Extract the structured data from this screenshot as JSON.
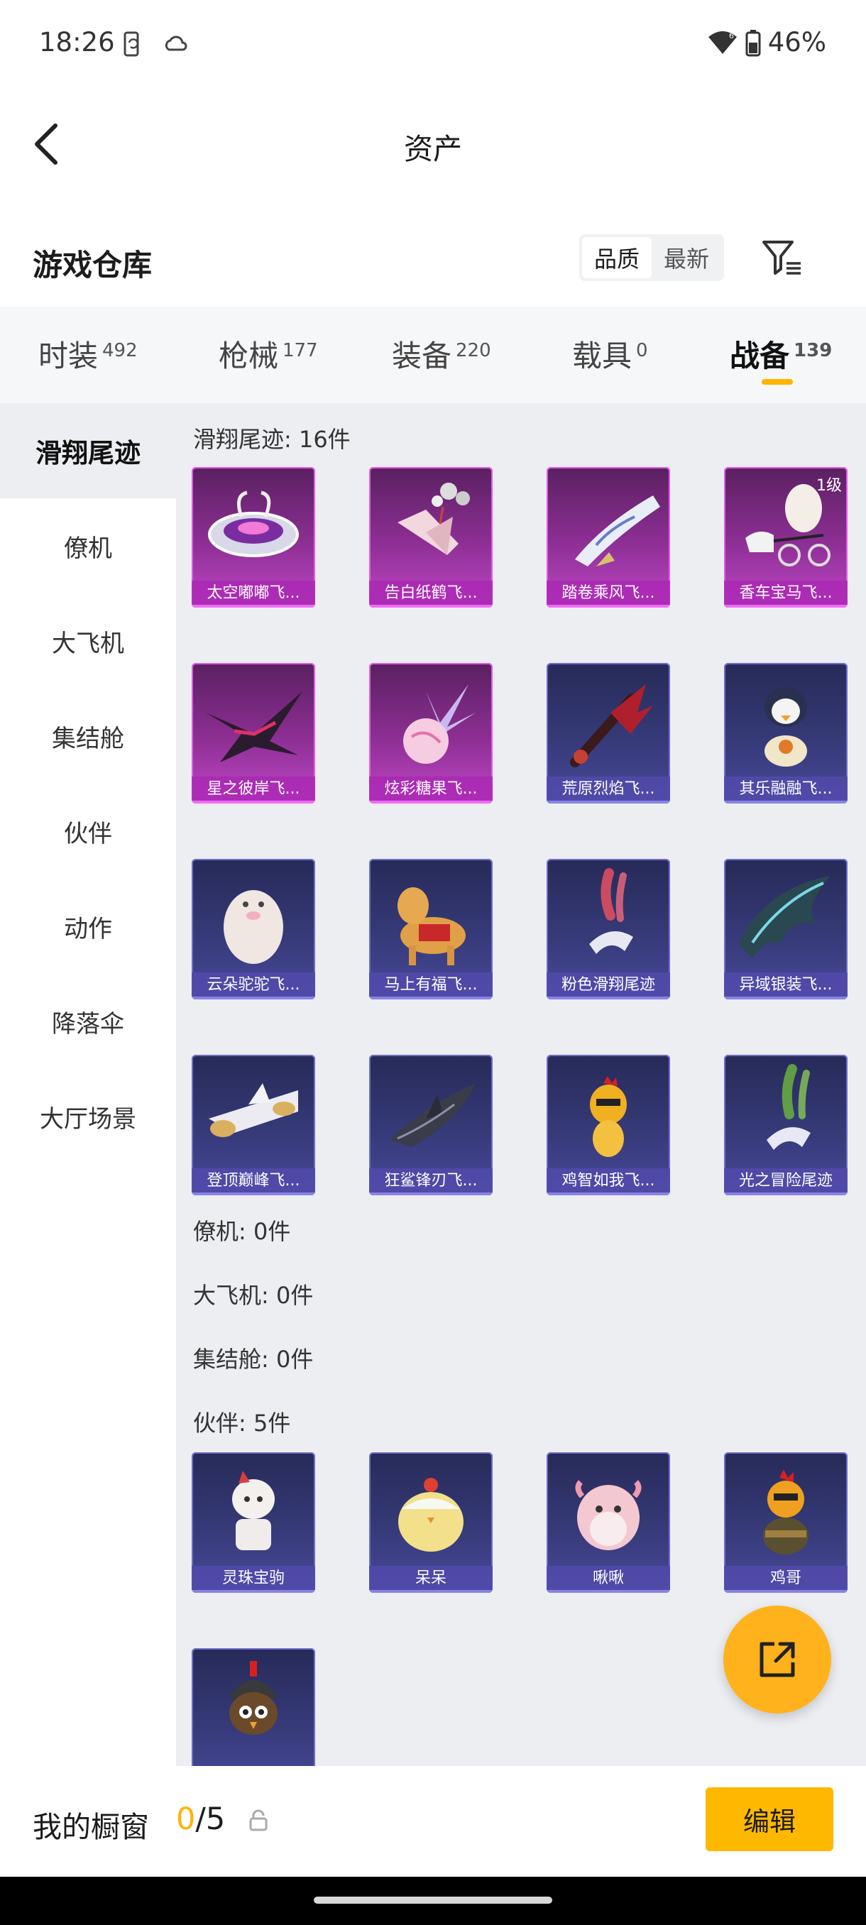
{
  "status_bar": {
    "time": "18:26",
    "battery": "46%"
  },
  "header": {
    "title": "资产"
  },
  "warehouse": {
    "title": "游戏仓库",
    "sort_options": [
      "品质",
      "最新"
    ],
    "active_sort": "品质"
  },
  "tabs": [
    {
      "label": "时装",
      "count": "492"
    },
    {
      "label": "枪械",
      "count": "177"
    },
    {
      "label": "装备",
      "count": "220"
    },
    {
      "label": "载具",
      "count": "0"
    },
    {
      "label": "战备",
      "count": "139"
    }
  ],
  "active_tab": "战备",
  "sidebar": {
    "items": [
      "滑翔尾迹",
      "僚机",
      "大飞机",
      "集结舱",
      "伙伴",
      "动作",
      "降落伞",
      "大厅场景"
    ],
    "active": "滑翔尾迹"
  },
  "sections": {
    "glide_trail": {
      "title": "滑翔尾迹: 16件",
      "items": [
        {
          "name": "太空嘟嘟飞...",
          "rarity": "purple",
          "icon": "space-ufo-icon"
        },
        {
          "name": "告白纸鹤飞...",
          "rarity": "purple",
          "icon": "paper-crane-icon"
        },
        {
          "name": "踏卷乘风飞...",
          "rarity": "purple",
          "icon": "scroll-icon"
        },
        {
          "name": "香车宝马飞...",
          "rarity": "purple",
          "icon": "carriage-icon",
          "level": "1级"
        },
        {
          "name": "星之彼岸飞...",
          "rarity": "purple",
          "icon": "dark-wing-icon"
        },
        {
          "name": "炫彩糖果飞...",
          "rarity": "purple",
          "icon": "candy-icon"
        },
        {
          "name": "荒原烈焰飞...",
          "rarity": "blue",
          "icon": "flame-glider-icon"
        },
        {
          "name": "其乐融融飞...",
          "rarity": "blue",
          "icon": "penguin-icon"
        },
        {
          "name": "云朵驼驼飞...",
          "rarity": "blue",
          "icon": "alpaca-icon"
        },
        {
          "name": "马上有福飞...",
          "rarity": "blue",
          "icon": "horse-icon"
        },
        {
          "name": "粉色滑翔尾迹",
          "rarity": "blue",
          "icon": "pink-smoke-icon"
        },
        {
          "name": "异域银装飞...",
          "rarity": "blue",
          "icon": "silver-wing-icon"
        },
        {
          "name": "登顶巅峰飞...",
          "rarity": "blue",
          "icon": "jet-icon"
        },
        {
          "name": "狂鲨锋刃飞...",
          "rarity": "blue",
          "icon": "shark-icon"
        },
        {
          "name": "鸡智如我飞...",
          "rarity": "blue",
          "icon": "chicken-icon"
        },
        {
          "name": "光之冒险尾迹",
          "rarity": "blue",
          "icon": "green-smoke-icon"
        }
      ]
    },
    "wingman": {
      "title": "僚机: 0件"
    },
    "big_plane": {
      "title": "大飞机: 0件"
    },
    "rally_pod": {
      "title": "集结舱: 0件"
    },
    "partner": {
      "title": "伙伴: 5件",
      "items": [
        {
          "name": "灵珠宝驹",
          "rarity": "blue",
          "icon": "pony-icon"
        },
        {
          "name": "呆呆",
          "rarity": "blue",
          "icon": "chick-icon"
        },
        {
          "name": "啾啾",
          "rarity": "blue",
          "icon": "pink-bird-icon"
        },
        {
          "name": "鸡哥",
          "rarity": "blue",
          "icon": "rooster-icon"
        },
        {
          "name": "",
          "rarity": "blue",
          "icon": "helmet-chick-icon"
        }
      ]
    }
  },
  "showcase": {
    "label": "我的橱窗",
    "current": "0",
    "total": "/5"
  },
  "edit_label": "编辑",
  "colors": {
    "accent": "#ffb400",
    "purple_rarity": "#c048c6",
    "blue_rarity": "#48489a"
  }
}
